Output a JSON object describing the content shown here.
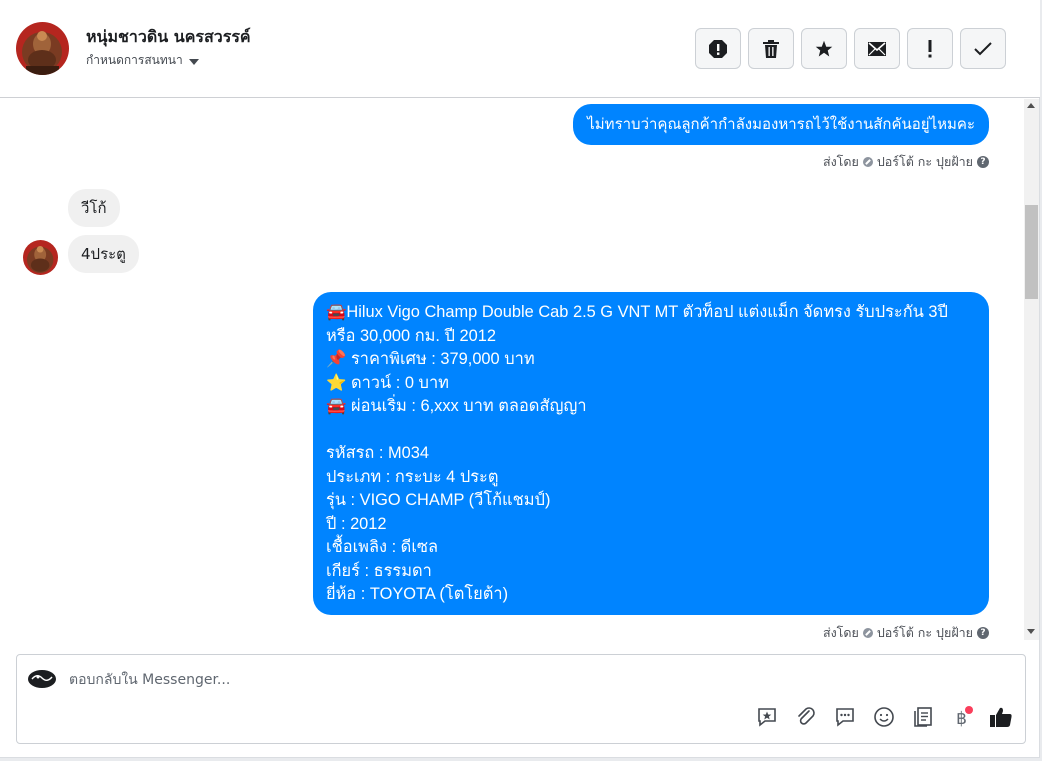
{
  "header": {
    "contact_name": "หนุ่มชาวดิน นครสวรรค์",
    "assign_label": "กำหนดการสนทนา",
    "actions": [
      {
        "name": "report-spam-icon",
        "label": "Spam"
      },
      {
        "name": "trash-icon",
        "label": "Delete"
      },
      {
        "name": "star-icon",
        "label": "Star"
      },
      {
        "name": "mail-icon",
        "label": "Mark unread"
      },
      {
        "name": "exclamation-icon",
        "label": "Follow up"
      },
      {
        "name": "check-icon",
        "label": "Done"
      }
    ]
  },
  "messages": {
    "out_1": "ไม่ทราบว่าคุณลูกค้ากำลังมองหารถไว้ใช้งานสักคันอยู่ไหมคะ",
    "sender_label": "ส่งโดย",
    "sender_name": "ปอร์โต้ กะ ปุยฝ้าย",
    "in_1": "วีโก้",
    "in_2": "4ประตู",
    "out_2": "🚘Hilux Vigo Champ Double Cab 2.5 G VNT MT ตัวท็อป แต่งแม็ก จัดทรง รับประกัน 3ปี หรือ 30,000 กม. ปี 2012\n📌 ราคาพิเศษ : 379,000 บาท\n⭐ ดาวน์ : 0 บาท\n🚘 ผ่อนเริ่ม : 6,xxx บาท ตลอดสัญญา\n\n   รหัสรถ : M034\n   ประเภท : กระบะ 4 ประตู\n   รุ่น : VIGO CHAMP (วีโก้แชมป์)\n   ปี : 2012\n   เชื้อเพลิง : ดีเซล\n   เกียร์ : ธรรมดา\n   ยี่ห้อ : TOYOTA (โตโยต้า)"
  },
  "composer": {
    "placeholder": "ตอบกลับใน Messenger...",
    "tools": [
      "saved-reply-icon",
      "attach-icon",
      "chat-bubble-icon",
      "emoji-icon",
      "catalog-icon",
      "baht-icon",
      "like-icon"
    ],
    "baht_symbol": "฿"
  },
  "colors": {
    "outgoing_bubble": "#0084ff",
    "incoming_bubble": "#f0f0f0",
    "notification_dot": "#fa3e5b"
  }
}
